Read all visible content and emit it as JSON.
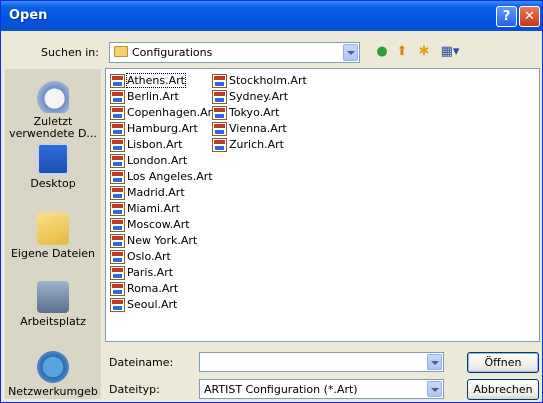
{
  "window": {
    "title": "Open"
  },
  "toolbar": {
    "look_in_label": "Suchen in:",
    "look_in_value": "Configurations",
    "back_icon": "back-icon",
    "up_icon": "up-folder-icon",
    "new_folder_icon": "new-folder-icon",
    "views_icon": "views-menu-icon"
  },
  "places": [
    {
      "label": "Zuletzt verwendete D...",
      "icon": "recent-documents-icon"
    },
    {
      "label": "Desktop",
      "icon": "desktop-icon"
    },
    {
      "label": "Eigene Dateien",
      "icon": "my-documents-icon"
    },
    {
      "label": "Arbeitsplatz",
      "icon": "my-computer-icon"
    },
    {
      "label": "Netzwerkumgeb",
      "icon": "network-icon"
    }
  ],
  "files": {
    "col1": [
      "Athens.Art",
      "Berlin.Art",
      "Copenhagen.Art",
      "Hamburg.Art",
      "Lisbon.Art",
      "London.Art",
      "Los Angeles.Art",
      "Madrid.Art",
      "Miami.Art",
      "Moscow.Art",
      "New York.Art",
      "Oslo.Art",
      "Paris.Art",
      "Roma.Art",
      "Seoul.Art"
    ],
    "col2": [
      "Stockholm.Art",
      "Sydney.Art",
      "Tokyo.Art",
      "Vienna.Art",
      "Zurich.Art"
    ]
  },
  "filename": {
    "label": "Dateiname:",
    "value": ""
  },
  "filetype": {
    "label": "Dateityp:",
    "value": "ARTIST Configuration (*.Art)"
  },
  "buttons": {
    "open": "Öffnen",
    "cancel": "Abbrechen"
  },
  "colors": {
    "titlebar": "#0054E3",
    "window_bg": "#ECE9D8",
    "places_bg": "#DAD6C5"
  }
}
